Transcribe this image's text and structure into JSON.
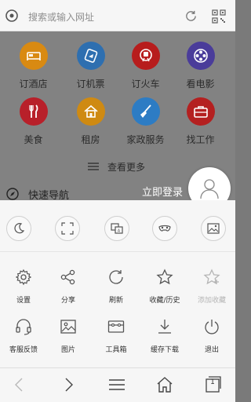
{
  "search": {
    "placeholder": "搜索或输入网址"
  },
  "grid": [
    {
      "label": "订酒店",
      "icon": "bed-icon",
      "color": "#d98a12"
    },
    {
      "label": "订机票",
      "icon": "plane-ticket-icon",
      "color": "#2e6fb0"
    },
    {
      "label": "订火车",
      "icon": "train-icon",
      "color": "#b71d1d"
    },
    {
      "label": "看电影",
      "icon": "film-reel-icon",
      "color": "#4a3c9a"
    },
    {
      "label": "美食",
      "icon": "fork-knife-icon",
      "color": "#b8202a"
    },
    {
      "label": "租房",
      "icon": "house-icon",
      "color": "#cf8a12"
    },
    {
      "label": "家政服务",
      "icon": "broom-icon",
      "color": "#2d7cc4"
    },
    {
      "label": "找工作",
      "icon": "briefcase-icon",
      "color": "#b42020"
    }
  ],
  "more": {
    "label": "查看更多"
  },
  "quick_nav": {
    "label": "快速导航"
  },
  "login": {
    "label": "立即登录"
  },
  "toggles": [
    {
      "icon": "moon-icon"
    },
    {
      "icon": "fullscreen-icon"
    },
    {
      "icon": "translate-icon"
    },
    {
      "icon": "incognito-mask-icon"
    },
    {
      "icon": "no-image-icon"
    }
  ],
  "menu": [
    {
      "label": "设置",
      "icon": "gear-icon",
      "disabled": false
    },
    {
      "label": "分享",
      "icon": "share-icon",
      "disabled": false
    },
    {
      "label": "刷新",
      "icon": "refresh-icon",
      "disabled": false
    },
    {
      "label": "收藏/历史",
      "icon": "star-icon",
      "disabled": false
    },
    {
      "label": "添加收藏",
      "icon": "star-add-icon",
      "disabled": true
    },
    {
      "label": "客服反馈",
      "icon": "headset-icon",
      "disabled": false
    },
    {
      "label": "图片",
      "icon": "image-icon",
      "disabled": false
    },
    {
      "label": "工具箱",
      "icon": "toolbox-icon",
      "disabled": false
    },
    {
      "label": "缓存下载",
      "icon": "download-icon",
      "disabled": false
    },
    {
      "label": "退出",
      "icon": "power-icon",
      "disabled": false
    }
  ],
  "toolbar": {
    "tab_count": "1"
  }
}
